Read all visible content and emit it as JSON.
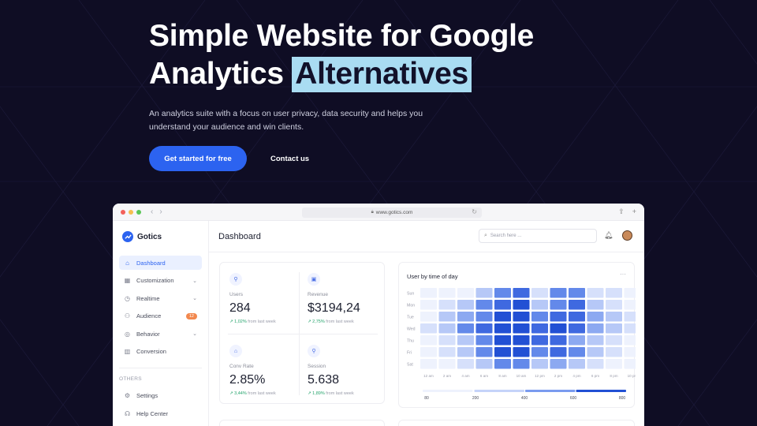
{
  "hero": {
    "title_line1": "Simple Website for Google",
    "title_line2_plain": "Analytics",
    "title_line2_highlight": "Alternatives",
    "subtitle": "An analytics suite with a focus on user privacy, data security and helps you understand your audience and win clients.",
    "primary_cta": "Get started for free",
    "secondary_cta": "Contact us"
  },
  "browser": {
    "url": "www.gotics.com",
    "dot_colors": [
      "#f3605a",
      "#f6be4f",
      "#5bc657"
    ]
  },
  "sidebar": {
    "brand": "Gotics",
    "items": [
      {
        "label": "Dashboard",
        "icon": "home-icon",
        "active": true
      },
      {
        "label": "Customization",
        "icon": "grid-icon",
        "chevron": true
      },
      {
        "label": "Realtime",
        "icon": "clock-icon",
        "chevron": true
      },
      {
        "label": "Audience",
        "icon": "users-icon",
        "badge": "12"
      },
      {
        "label": "Behavior",
        "icon": "compass-icon",
        "chevron": true
      },
      {
        "label": "Conversion",
        "icon": "bar-chart-icon"
      }
    ],
    "others_label": "OTHERS",
    "others": [
      {
        "label": "Settings",
        "icon": "gear-icon"
      },
      {
        "label": "Help Center",
        "icon": "headset-icon"
      }
    ]
  },
  "dashboard": {
    "title": "Dashboard",
    "search_placeholder": "Search here ...",
    "stats": [
      {
        "label": "Users",
        "value": "284",
        "change": "1,02%",
        "suffix": "from last week",
        "icon": "user-icon"
      },
      {
        "label": "Revenue",
        "value": "$3194,24",
        "change": "2,75%",
        "suffix": "from last week",
        "icon": "wallet-icon"
      },
      {
        "label": "Conv Rate",
        "value": "2.85%",
        "change": "3,44%",
        "suffix": "from last week",
        "icon": "building-icon"
      },
      {
        "label": "Session",
        "value": "5.638",
        "change": "1,89%",
        "suffix": "from last week",
        "icon": "person-icon"
      }
    ]
  },
  "chart_data": {
    "type": "heatmap",
    "title": "User by time of day",
    "rows": [
      "Sun",
      "Mon",
      "Tue",
      "Wed",
      "Thu",
      "Fri",
      "Sat"
    ],
    "columns": [
      "12 am",
      "2 am",
      "4 am",
      "6 am",
      "8 am",
      "10 am",
      "12 pm",
      "2 pm",
      "4 pm",
      "6 pm",
      "8 pm",
      "10 pm"
    ],
    "values": [
      [
        100,
        150,
        150,
        350,
        550,
        650,
        200,
        500,
        550,
        250,
        200,
        150
      ],
      [
        150,
        200,
        300,
        500,
        650,
        700,
        350,
        550,
        650,
        300,
        250,
        150
      ],
      [
        150,
        300,
        450,
        550,
        700,
        750,
        500,
        600,
        650,
        400,
        300,
        200
      ],
      [
        200,
        350,
        500,
        650,
        800,
        800,
        650,
        700,
        600,
        450,
        300,
        200
      ],
      [
        150,
        250,
        350,
        550,
        750,
        800,
        650,
        650,
        450,
        350,
        250,
        150
      ],
      [
        100,
        200,
        300,
        550,
        700,
        750,
        500,
        600,
        550,
        300,
        200,
        150
      ],
      [
        100,
        150,
        200,
        350,
        550,
        550,
        350,
        400,
        350,
        200,
        150,
        100
      ]
    ],
    "legend_ticks": [
      "80",
      "200",
      "400",
      "600",
      "800"
    ],
    "color_scale": [
      "#eef2fd",
      "#d6e0fb",
      "#b6c8f7",
      "#8ca9f1",
      "#6389ea",
      "#3f69e0",
      "#2250d4"
    ]
  }
}
